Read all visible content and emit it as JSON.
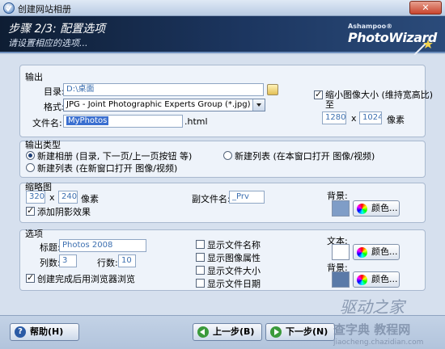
{
  "window": {
    "title": "创建网站相册",
    "close_glyph": "✕"
  },
  "header": {
    "step_title": "步骤 2/3: 配置选项",
    "step_subtitle": "请设置相应的选项...",
    "brand_small": "Ashampoo®",
    "brand_name": "PhotoWizard"
  },
  "output": {
    "section_label": "输出",
    "directory_label": "目录:",
    "directory_value": "D:\\桌面",
    "format_label": "格式:",
    "format_value": "JPG - Joint Photographic Experts Group (*.jpg)",
    "filename_label": "文件名:",
    "filename_value": "MyPhotos",
    "filename_ext": ".html",
    "shrink_label_1": "缩小图像大小 (维持宽高比)",
    "shrink_label_2": "至",
    "shrink_checked": true,
    "width_value": "1280",
    "height_value": "1024",
    "times": "x",
    "unit": "像素"
  },
  "output_type": {
    "section_label": "输出类型",
    "options": [
      {
        "label": "新建相册 (目录, 下一页/上一页按钮 等)",
        "checked": true
      },
      {
        "label": "新建列表 (在本窗口打开 图像/视频)",
        "checked": false
      },
      {
        "label": "新建列表 (在新窗口打开 图像/视频)",
        "checked": false
      }
    ]
  },
  "thumbnail": {
    "section_label": "缩略图",
    "width_value": "320",
    "height_value": "240",
    "times": "x",
    "unit": "像素",
    "suffix_label": "副文件名:",
    "suffix_value": "_Prv",
    "shadow_label": "添加阴影效果",
    "shadow_checked": true,
    "background_label": "背景:",
    "background_color": "#7f9dc7",
    "color_button": "颜色..."
  },
  "options": {
    "section_label": "选项",
    "title_label": "标题:",
    "title_value": "Photos 2008",
    "columns_label": "列数:",
    "columns_value": "3",
    "rows_label": "行数:",
    "rows_value": "10",
    "browser_label": "创建完成后用浏览器浏览",
    "browser_checked": true,
    "show_checks": [
      {
        "label": "显示文件名称",
        "checked": false
      },
      {
        "label": "显示图像属性",
        "checked": false
      },
      {
        "label": "显示文件大小",
        "checked": false
      },
      {
        "label": "显示文件日期",
        "checked": false
      }
    ],
    "text_label": "文本:",
    "text_color": "#ffffff",
    "text_color_button": "颜色...",
    "background_label": "背景:",
    "background_color": "#5a7aa8",
    "background_color_button": "颜色..."
  },
  "footer": {
    "help": "帮助(H)",
    "back": "上一步(B)",
    "next": "下一步(N)"
  },
  "watermark": {
    "line1": "驱动之家",
    "line2": "查字典 教程网",
    "line3": "jiaocheng.chazidian.com"
  }
}
